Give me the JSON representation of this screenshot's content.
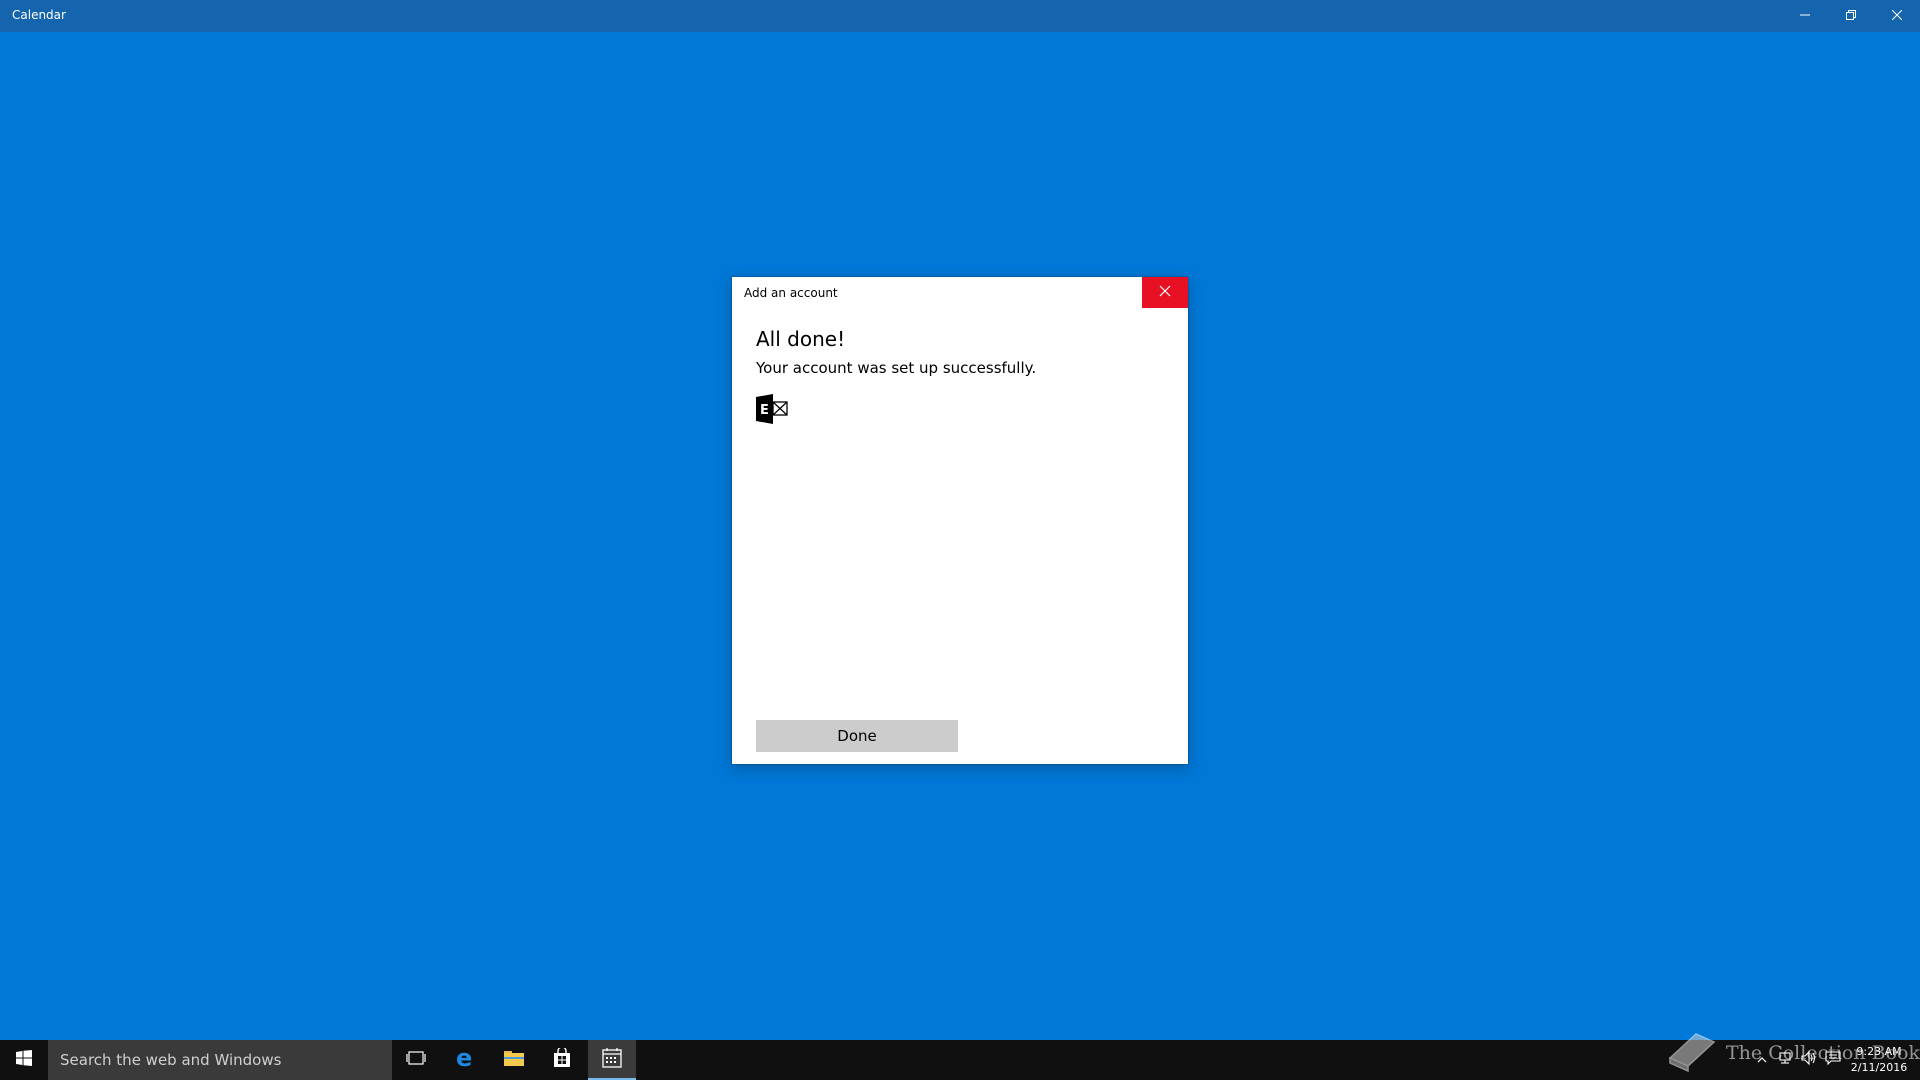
{
  "window": {
    "title": "Calendar",
    "controls": {
      "minimize_icon": "minimize-icon",
      "restore_icon": "restore-icon",
      "close_icon": "close-icon"
    }
  },
  "dialog": {
    "title": "Add an account",
    "heading": "All done!",
    "message": "Your account was set up successfully.",
    "account_icon": "exchange-icon",
    "done_label": "Done",
    "close_color": "#e81123"
  },
  "taskbar": {
    "search_placeholder": "Search the web and Windows",
    "pinned": [
      {
        "name": "task-view",
        "icon": "task-view-icon"
      },
      {
        "name": "edge",
        "icon": "edge-icon"
      },
      {
        "name": "file-explorer",
        "icon": "folder-icon"
      },
      {
        "name": "store",
        "icon": "store-icon"
      },
      {
        "name": "calendar",
        "icon": "calendar-icon",
        "active": true
      }
    ],
    "tray_icons": [
      "chevron-up-icon",
      "network-icon",
      "volume-icon",
      "action-center-icon"
    ],
    "clock": {
      "time": "9:23 AM",
      "date": "2/11/2016"
    }
  },
  "watermark": {
    "text": "The Collection Book"
  },
  "colors": {
    "desktop": "#0078d7",
    "titlebar": "#1465ad",
    "taskbar": "#101010",
    "accent_active": "#76b9ed"
  }
}
